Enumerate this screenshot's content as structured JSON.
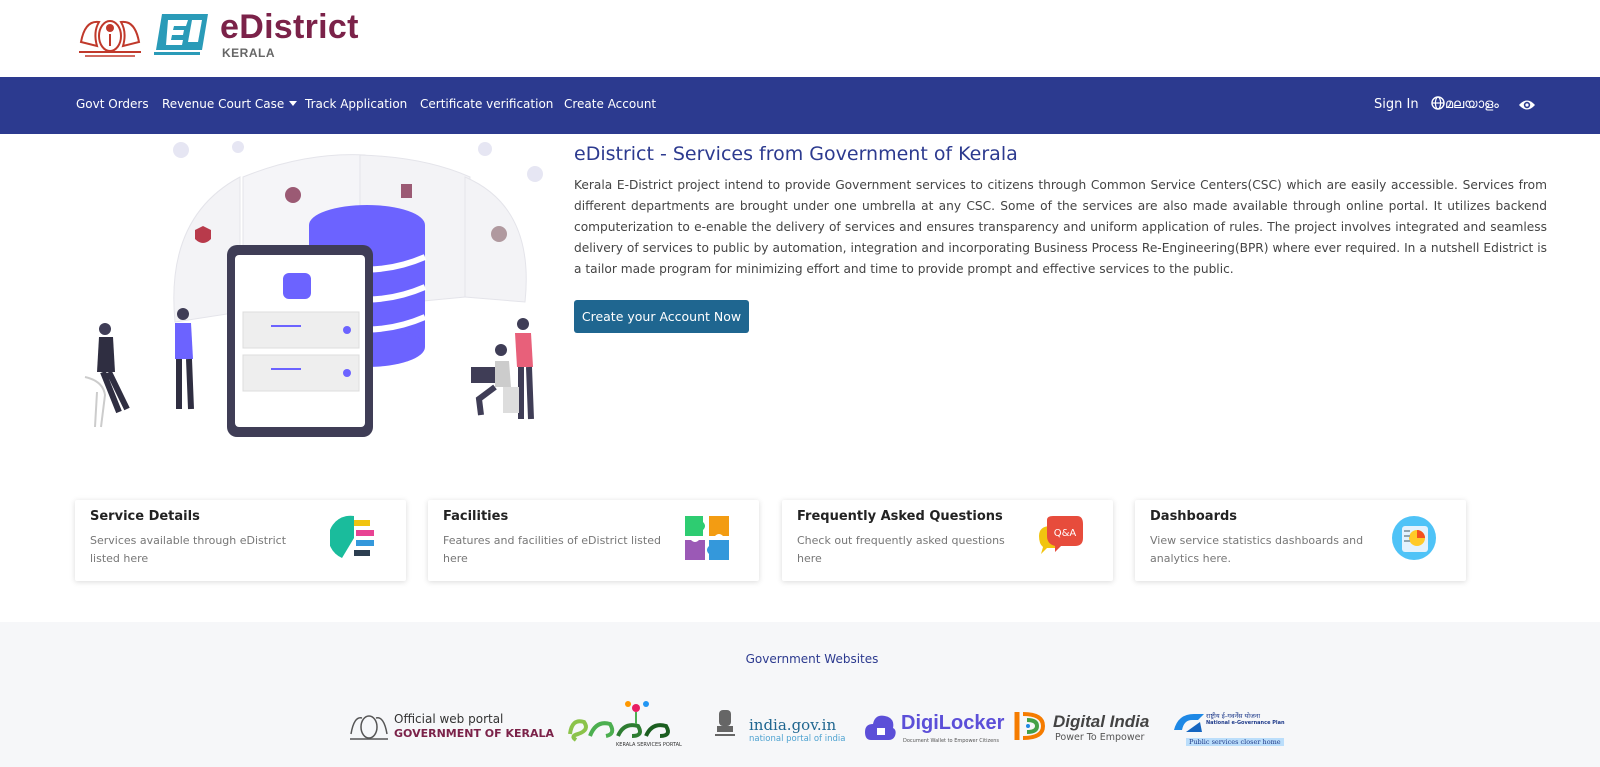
{
  "header": {
    "brand_title": "eDistrict",
    "brand_subtitle": "KERALA"
  },
  "nav": {
    "items": [
      {
        "label": "Govt Orders"
      },
      {
        "label": "Revenue Court Case"
      },
      {
        "label": "Track Application"
      },
      {
        "label": "Certificate verification"
      },
      {
        "label": "Create Account"
      }
    ],
    "sign_in": "Sign In",
    "language": "മലയാളം"
  },
  "hero": {
    "title": "eDistrict - Services from Government of Kerala",
    "description": "Kerala E-District project intend to provide Government services to citizens through Common Service Centers(CSC) which are easily accessible. Services from different departments are brought under one umbrella at any CSC. Some of the services are also made available through online portal. It utilizes backend computerization to e-enable the delivery of services and ensures transparency and uniform application of rules. The project involves integrated and seamless delivery of services to public by automation, integration and incorporating Business Process Re-Engineering(BPR) where ever required. In a nutshell Edistrict is a tailor made program for minimizing effort and time to provide prompt and effective services to the public.",
    "cta_label": "Create your Account Now"
  },
  "cards": [
    {
      "title": "Service Details",
      "description": "Services available through eDistrict listed here"
    },
    {
      "title": "Facilities",
      "description": "Features and facilities of eDistrict listed here"
    },
    {
      "title": "Frequently Asked Questions",
      "description": "Check out frequently asked questions here"
    },
    {
      "title": "Dashboards",
      "description": "View service statistics dashboards and analytics here."
    }
  ],
  "footer": {
    "title": "Government Websites",
    "partners": [
      {
        "line1": "Official web portal",
        "line2": "GOVERNMENT OF KERALA"
      },
      {
        "line1": "KERALA SERVICES PORTAL"
      },
      {
        "line1": "india.gov.in",
        "line2": "national portal of india"
      },
      {
        "line1": "DigiLocker",
        "line2": "Document Wallet to Empower Citizens"
      },
      {
        "line1": "Digital India",
        "line2": "Power To Empower"
      },
      {
        "line1": "राष्ट्रीय ई-गवर्नेंस योजना",
        "line2": "National e-Governance Plan",
        "line3": "Public services closer home"
      }
    ]
  },
  "colors": {
    "navbar": "#2c3a8f",
    "brand": "#7b2249",
    "cta": "#1f6690",
    "hero_title": "#2c3a8f"
  }
}
